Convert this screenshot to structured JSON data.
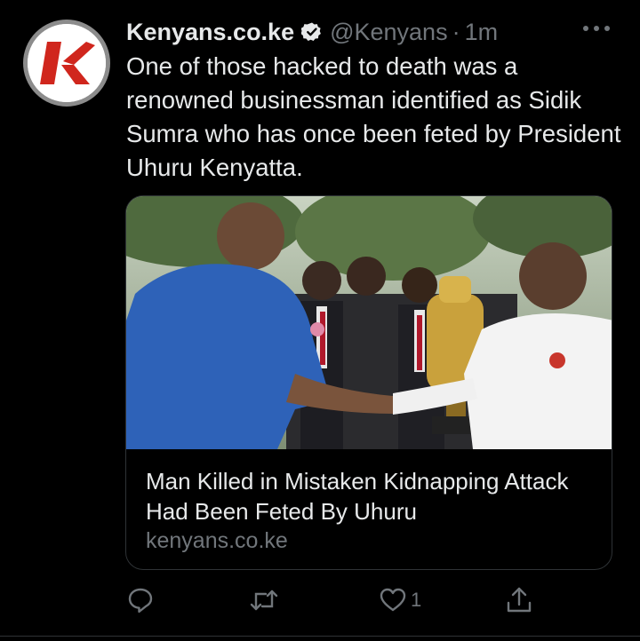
{
  "tweet": {
    "author": {
      "display_name": "Kenyans.co.ke",
      "verified": true,
      "handle": "@Kenyans",
      "separator": "·",
      "time": "1m",
      "avatar_icon": "kenyans-k-logo-icon"
    },
    "text": "One of those hacked to death was a renowned businessman identified as Sidik Sumra who has once been feted by President Uhuru Kenyatta.",
    "card": {
      "title": "Man Killed in Mistaken Kidnapping Attack Had Been Feted By Uhuru",
      "domain": "kenyans.co.ke",
      "image_icon": "article-photo"
    },
    "actions": {
      "reply_icon": "reply-icon",
      "retweet_icon": "retweet-icon",
      "like_icon": "heart-icon",
      "like_count": "1",
      "share_icon": "share-icon"
    }
  },
  "colors": {
    "background": "#000000",
    "primary_text": "#e7e9ea",
    "secondary_text": "#71767b",
    "border": "#2f3336",
    "brand_red": "#d0261d"
  }
}
